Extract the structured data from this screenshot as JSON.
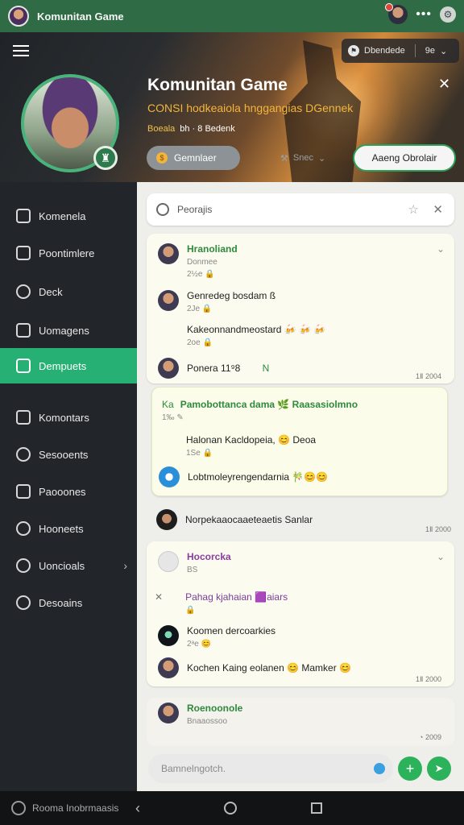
{
  "statusbar": {
    "title": "Komunitan Game",
    "more": "•••"
  },
  "header": {
    "title": "Komunitan Game",
    "subtitle": "CONSI hodkeaiola hnggangias DGennek",
    "meta_a": "Boeala",
    "meta_b": "bh · 8 Bedenk",
    "topright_label": "Dbendede",
    "topright_extra": "9e",
    "btn_gray": "Gemnlaer",
    "btn_ghost": "Snec",
    "btn_green": "Aaeng Obrolair"
  },
  "sidebar": {
    "items": [
      {
        "label": "Komenela"
      },
      {
        "label": "Poontimlere"
      },
      {
        "label": "Deck"
      },
      {
        "label": "Uomagens"
      },
      {
        "label": "Dempuets"
      },
      {
        "label": "Komontars"
      },
      {
        "label": "Sesooents"
      },
      {
        "label": "Paooones"
      },
      {
        "label": "Hooneets"
      },
      {
        "label": "Uoncioals"
      },
      {
        "label": "Desoains"
      }
    ]
  },
  "search": {
    "placeholder": "Peorajis"
  },
  "messages": {
    "a1": {
      "name": "Hranoliand",
      "sub": "Donmee",
      "time": "2½e"
    },
    "a2": {
      "text": "Genredeg bosdam  ß",
      "time": "2Je"
    },
    "a3": {
      "text": "Kakeonnandmeostard 🍻 🍻 🍻",
      "time": "2oe"
    },
    "a4": {
      "text": "Ponera 11⁹8",
      "extra": "N",
      "time": "1Ⅱ 2004"
    },
    "b1": {
      "prefix": "Ka",
      "name": "Pamobottanca dama 🌿 Raasasiolmno",
      "time": "1‰"
    },
    "b2": {
      "text": "Halonan Kacldopeia, 😊 Deoa",
      "time": "1Se"
    },
    "b3": {
      "text": "Lobtmoleyrengendarnia 🎋😊😊"
    },
    "s1": {
      "text": "Norpekaaocaaeteaetis Sanlar",
      "time": "1Ⅱ 2000"
    },
    "c1": {
      "name": "Hocorcka",
      "sub": "BS"
    },
    "c2": {
      "text": "Pahag kjahaian 🟪aiars"
    },
    "c3": {
      "text": "Koomen dercoarkies",
      "time": "2ᵃe"
    },
    "c4": {
      "text": "Kochen Kaing eolanen 😊 Mamker 😊",
      "time": "1Ⅱ 2000"
    },
    "d1": {
      "name": "Roenoonole",
      "sub": "Bnaaossoo",
      "time": "2009"
    }
  },
  "composer": {
    "placeholder": "Bamnelngotch."
  },
  "bottombar": {
    "label": "Rooma Inobrmaasis"
  }
}
